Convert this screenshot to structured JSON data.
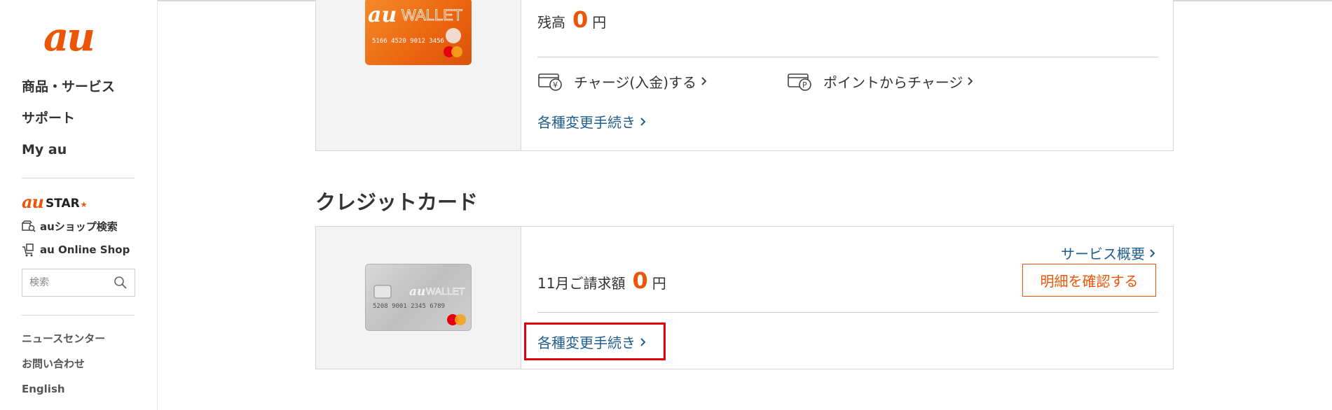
{
  "sidebar": {
    "logo_text": "au",
    "nav": [
      "商品・サービス",
      "サポート",
      "My au"
    ],
    "austar_au": "au",
    "austar_star": "STAR",
    "shop_search": "auショップ検索",
    "online_shop": "au Online Shop",
    "search_placeholder": "検索",
    "bottom_links": [
      "ニュースセンター",
      "お問い合わせ",
      "English"
    ]
  },
  "wallet": {
    "balance_label": "残高",
    "balance_value": "0",
    "currency": "円",
    "charge_label": "チャージ(入金)する",
    "point_charge_label": "ポイントからチャージ",
    "procedures_label": "各種変更手続き",
    "card_brand": "WALLET",
    "card_number": "5166 4520 9012 3456"
  },
  "credit": {
    "section_title": "クレジットカード",
    "service_overview": "サービス概要",
    "billing_label": "11月ご請求額",
    "billing_value": "0",
    "currency": "円",
    "details_button": "明細を確認する",
    "procedures_label": "各種変更手続き",
    "card_brand": "WALLET",
    "card_number": "5208 9001 2345 6789"
  },
  "colors": {
    "accent": "#eb5505",
    "link": "#1f5d8c",
    "highlight": "#e3000f"
  }
}
